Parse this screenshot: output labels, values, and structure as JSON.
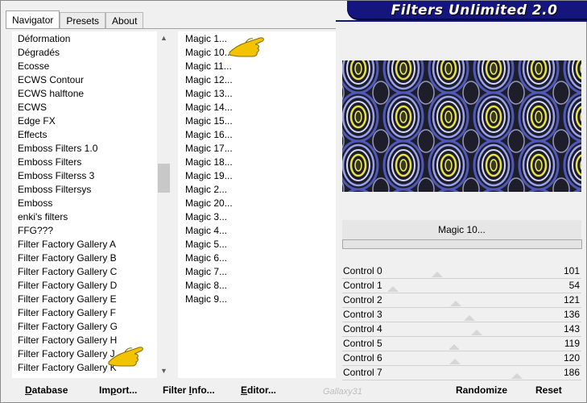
{
  "app": {
    "title": "Filters Unlimited 2.0"
  },
  "tabs": [
    {
      "label": "Navigator",
      "active": true
    },
    {
      "label": "Presets",
      "active": false
    },
    {
      "label": "About",
      "active": false
    }
  ],
  "categories": [
    "Déformation",
    "Dégradés",
    "Ecosse",
    "ECWS Contour",
    "ECWS halftone",
    "ECWS",
    "Edge FX",
    "Effects",
    "Emboss Filters 1.0",
    "Emboss Filters",
    "Emboss Filterss 3",
    "Emboss Filtersys",
    "Emboss",
    "enki's filters",
    "FFG???",
    "Filter Factory Gallery A",
    "Filter Factory Gallery B",
    "Filter Factory Gallery C",
    "Filter Factory Gallery D",
    "Filter Factory Gallery E",
    "Filter Factory Gallery F",
    "Filter Factory Gallery G",
    "Filter Factory Gallery H",
    "Filter Factory Gallery J",
    "Filter Factory Gallery K"
  ],
  "filters": [
    "Magic 1...",
    "Magic 10...",
    "Magic 11...",
    "Magic 12...",
    "Magic 13...",
    "Magic 14...",
    "Magic 15...",
    "Magic 16...",
    "Magic 17...",
    "Magic 18...",
    "Magic 19...",
    "Magic 2...",
    "Magic 20...",
    "Magic 3...",
    "Magic 4...",
    "Magic 5...",
    "Magic 6...",
    "Magic 7...",
    "Magic 8...",
    "Magic 9..."
  ],
  "preview": {
    "filter_name": "Magic 10..."
  },
  "controls": [
    {
      "label": "Control 0",
      "value": "101",
      "fraction": 0.396
    },
    {
      "label": "Control 1",
      "value": "54",
      "fraction": 0.212
    },
    {
      "label": "Control 2",
      "value": "121",
      "fraction": 0.475
    },
    {
      "label": "Control 3",
      "value": "136",
      "fraction": 0.533
    },
    {
      "label": "Control 4",
      "value": "143",
      "fraction": 0.561
    },
    {
      "label": "Control 5",
      "value": "119",
      "fraction": 0.467
    },
    {
      "label": "Control 6",
      "value": "120",
      "fraction": 0.471
    },
    {
      "label": "Control 7",
      "value": "186",
      "fraction": 0.729
    }
  ],
  "buttons": {
    "database": {
      "u": "D",
      "rest": "atabase"
    },
    "import": {
      "pre": "Im",
      "u": "p",
      "rest": "ort..."
    },
    "filter_info": {
      "pre": "Filter ",
      "u": "I",
      "rest": "nfo..."
    },
    "editor": {
      "u": "E",
      "rest": "ditor..."
    },
    "randomize": "Randomize",
    "reset": "Reset"
  },
  "watermark": "Gallaxy31",
  "colors": {
    "banner": "#15157e",
    "pattern_blue": "#8a92e8",
    "pattern_yellow": "#e6e23a"
  }
}
